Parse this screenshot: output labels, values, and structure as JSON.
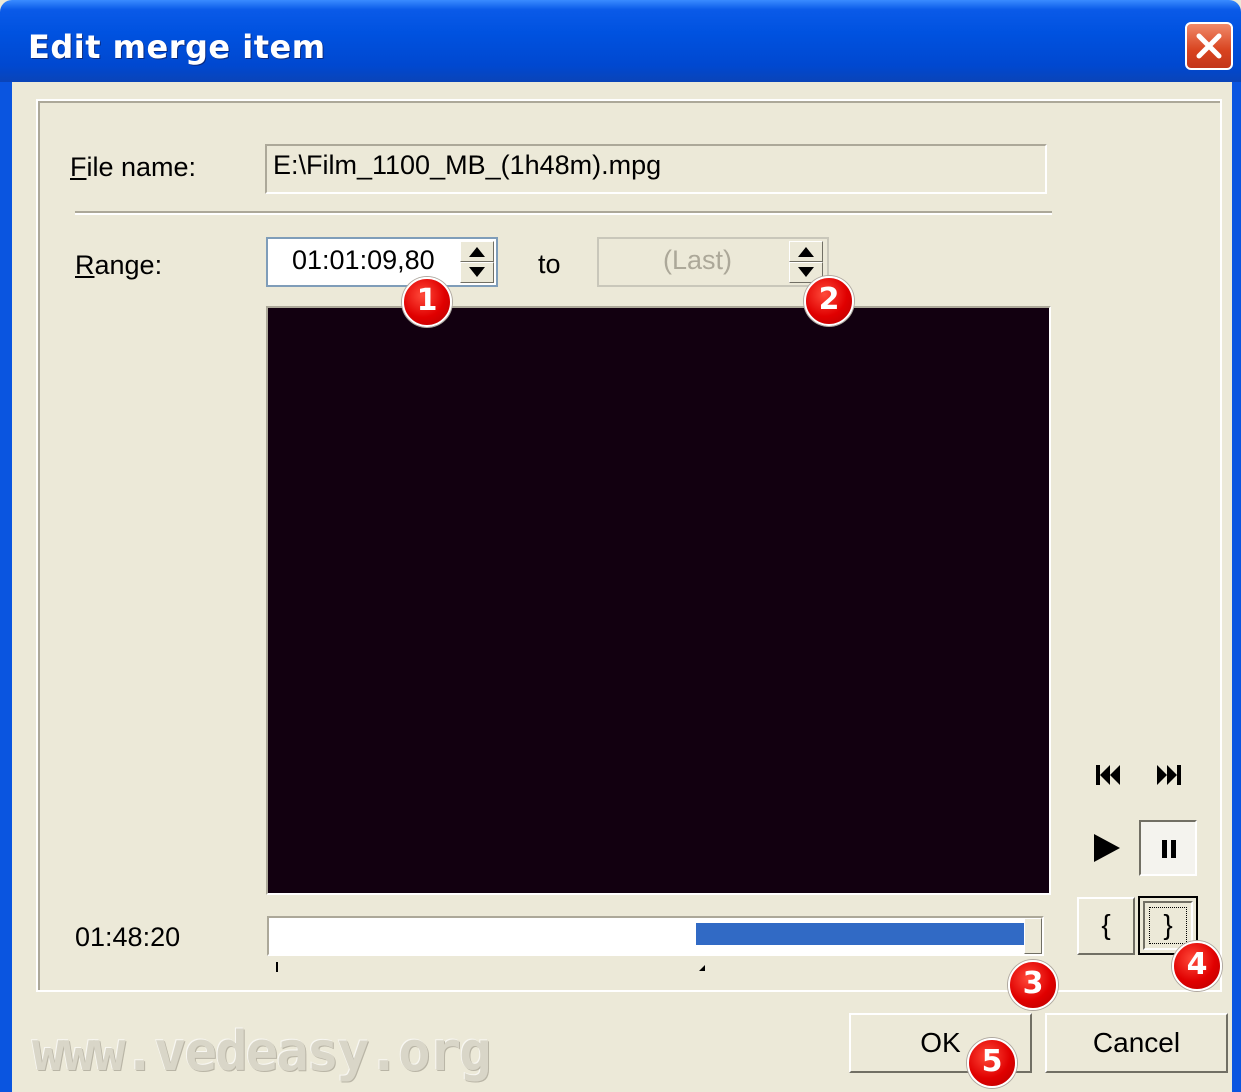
{
  "window": {
    "title": "Edit merge item"
  },
  "file": {
    "label_first": "F",
    "label_rest": "ile name:",
    "value": "E:\\Film_1100_MB_(1h48m).mpg"
  },
  "range": {
    "label_first": "R",
    "label_rest": "ange:",
    "start_value": "01:01:09,80",
    "to_label": "to",
    "end_value": "(Last)"
  },
  "playback": {
    "time": "01:48:20",
    "position_fraction": 1.0,
    "selection_start_fraction": 0.565,
    "selection_end_fraction": 1.0
  },
  "controls": {
    "mark_start_label": "{",
    "mark_end_label": "}"
  },
  "buttons": {
    "ok": "OK",
    "cancel": "Cancel"
  },
  "badges": [
    "1",
    "2",
    "3",
    "4",
    "5"
  ],
  "watermark": "www.vedeasy.org",
  "colors": {
    "title_bar": "#0052e0",
    "selection": "#316ac5",
    "badge": "#e00000",
    "video_bg": "#120010"
  }
}
